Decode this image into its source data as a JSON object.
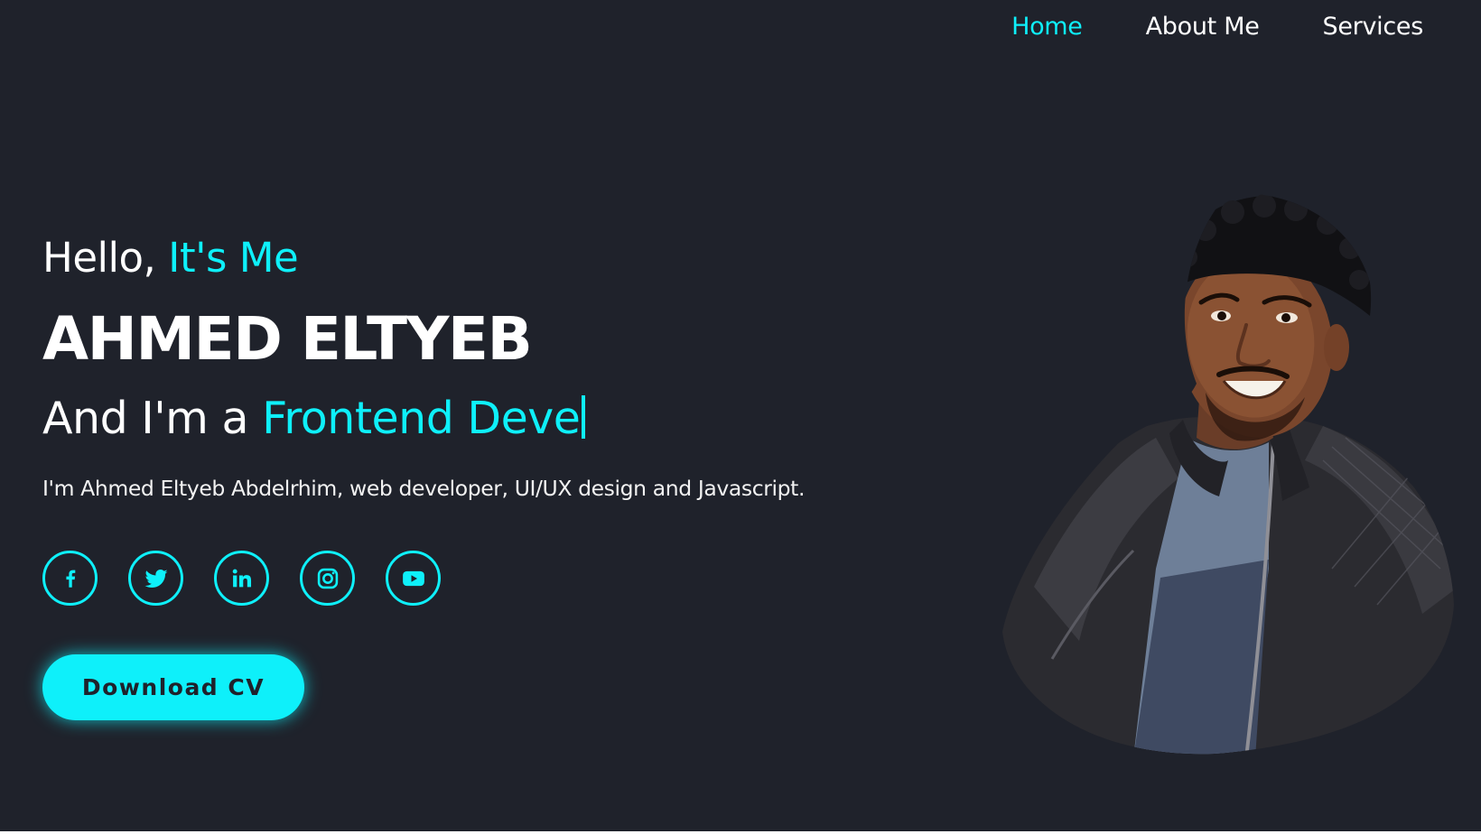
{
  "nav": {
    "items": [
      {
        "label": "Home",
        "active": true
      },
      {
        "label": "About Me",
        "active": false
      },
      {
        "label": "Services",
        "active": false
      }
    ]
  },
  "hero": {
    "greeting_prefix": "Hello, ",
    "greeting_accent": "It's Me",
    "name": "AHMED ELTYEB",
    "role_prefix": "And I'm a ",
    "role_typed": "Frontend Deve",
    "intro": "I'm Ahmed Eltyeb Abdelrhim, web developer, UI/UX design and Javascript."
  },
  "socials": [
    {
      "icon": "facebook-icon"
    },
    {
      "icon": "twitter-icon"
    },
    {
      "icon": "linkedin-icon"
    },
    {
      "icon": "instagram-icon"
    },
    {
      "icon": "youtube-icon"
    }
  ],
  "cta": {
    "label": "Download CV"
  },
  "colors": {
    "background": "#1f222b",
    "accent": "#0ef0fa",
    "text": "#ffffff"
  }
}
